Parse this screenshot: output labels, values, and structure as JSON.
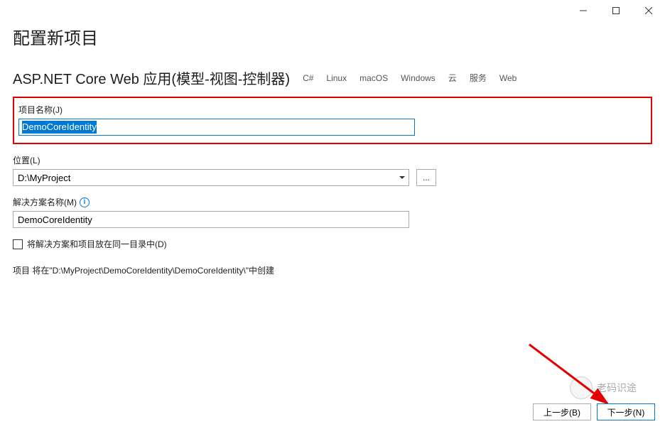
{
  "window": {
    "title": "配置新项目"
  },
  "project": {
    "template_name": "ASP.NET Core Web 应用(模型-视图-控制器)",
    "tags": [
      "C#",
      "Linux",
      "macOS",
      "Windows",
      "云",
      "服务",
      "Web"
    ]
  },
  "fields": {
    "project_name": {
      "label": "项目名称(J)",
      "value": "DemoCoreIdentity"
    },
    "location": {
      "label": "位置(L)",
      "value": "D:\\MyProject",
      "browse": "..."
    },
    "solution_name": {
      "label": "解决方案名称(M)",
      "value": "DemoCoreIdentity"
    },
    "same_directory": {
      "label": "将解决方案和项目放在同一目录中(D)",
      "checked": false
    }
  },
  "path_info": "项目 将在\"D:\\MyProject\\DemoCoreIdentity\\DemoCoreIdentity\\\"中创建",
  "buttons": {
    "back": "上一步(B)",
    "next": "下一步(N)"
  },
  "watermark": {
    "text": "老码识途"
  },
  "info_icon_glyph": "i"
}
